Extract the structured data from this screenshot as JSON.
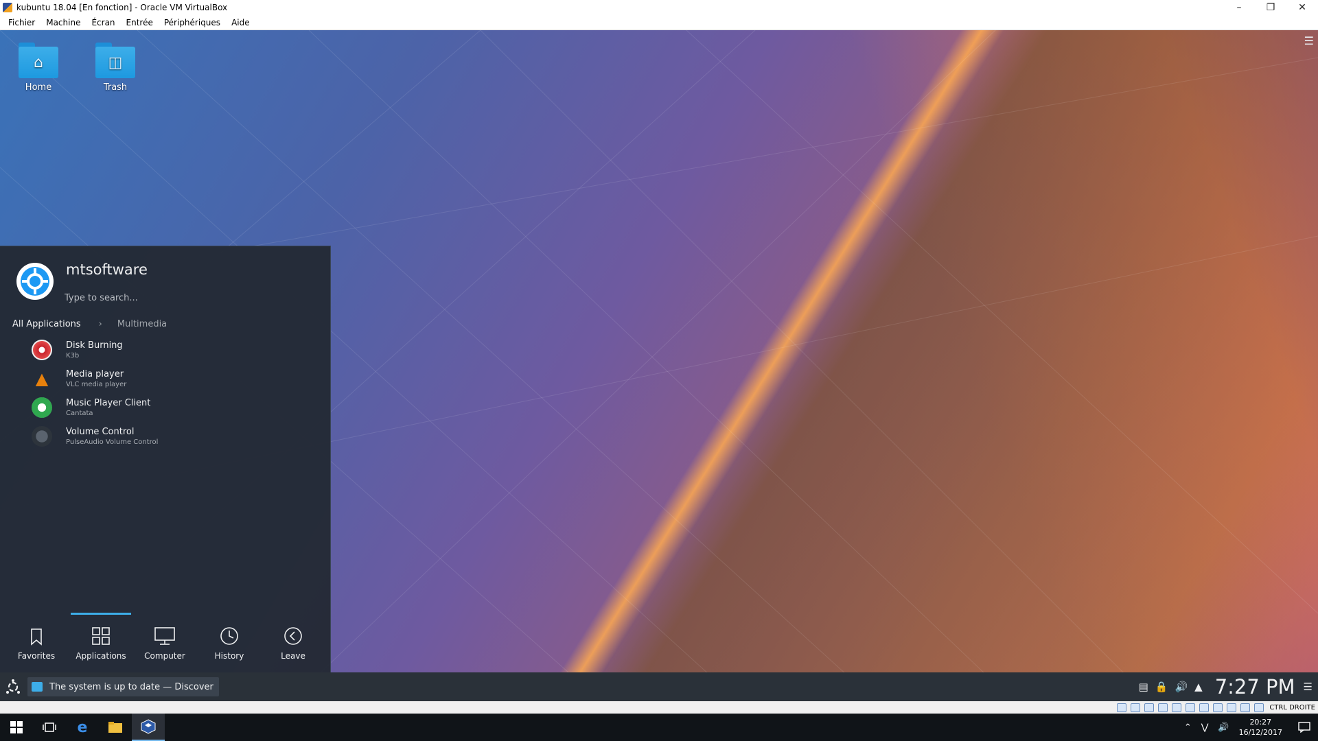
{
  "vbox": {
    "title": "kubuntu 18.04 [En fonction] - Oracle VM VirtualBox",
    "menu": [
      "Fichier",
      "Machine",
      "Écran",
      "Entrée",
      "Périphériques",
      "Aide"
    ],
    "status_key": "CTRL DROITE"
  },
  "desktop": {
    "icons": [
      {
        "label": "Home",
        "icon": "home-icon"
      },
      {
        "label": "Trash",
        "icon": "trash-icon"
      }
    ]
  },
  "kickoff": {
    "user": "mtsoftware",
    "search_placeholder": "Type to search...",
    "breadcrumb": {
      "root": "All Applications",
      "current": "Multimedia"
    },
    "apps": [
      {
        "name": "Disk Burning",
        "sub": "K3b",
        "color": "#c8232c"
      },
      {
        "name": "Media player",
        "sub": "VLC media player",
        "color": "#e8810c"
      },
      {
        "name": "Music Player Client",
        "sub": "Cantata",
        "color": "#2fa84f"
      },
      {
        "name": "Volume Control",
        "sub": "PulseAudio Volume Control",
        "color": "#3c4550"
      }
    ],
    "tabs": [
      "Favorites",
      "Applications",
      "Computer",
      "History",
      "Leave"
    ],
    "active_tab": "Applications"
  },
  "panel": {
    "task": "The system is up to date — Discover",
    "clock": "7:27 PM"
  },
  "windows": {
    "time": "20:27",
    "date": "16/12/2017"
  }
}
